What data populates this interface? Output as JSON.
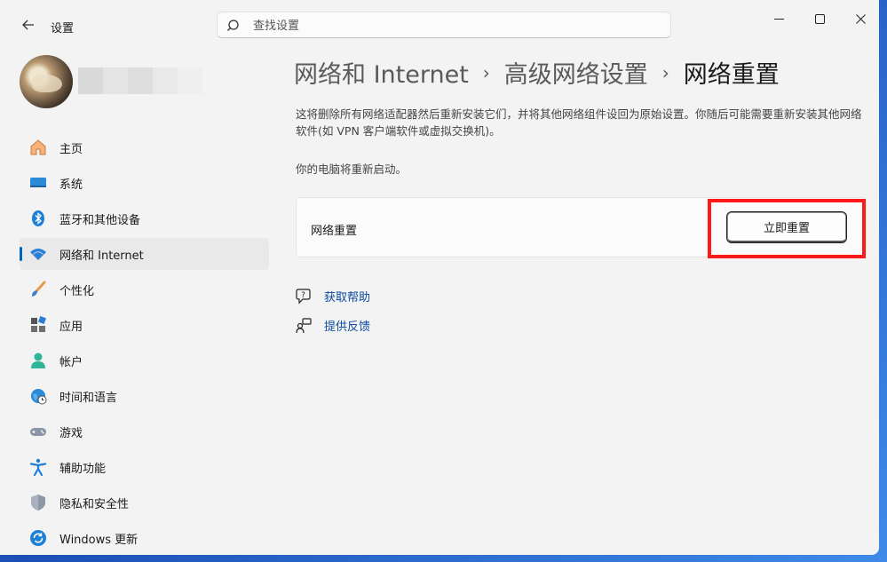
{
  "app": {
    "title": "设置",
    "back_label": "←"
  },
  "search": {
    "placeholder": "查找设置",
    "value": ""
  },
  "window_controls": {
    "minimize": "—",
    "maximize": "☐",
    "close": "✕"
  },
  "sidebar": {
    "items": [
      {
        "label": "主页",
        "icon": "home-icon"
      },
      {
        "label": "系统",
        "icon": "system-icon"
      },
      {
        "label": "蓝牙和其他设备",
        "icon": "bluetooth-icon"
      },
      {
        "label": "网络和 Internet",
        "icon": "wifi-icon",
        "active": true
      },
      {
        "label": "个性化",
        "icon": "brush-icon"
      },
      {
        "label": "应用",
        "icon": "apps-icon"
      },
      {
        "label": "帐户",
        "icon": "account-icon"
      },
      {
        "label": "时间和语言",
        "icon": "globe-clock-icon"
      },
      {
        "label": "游戏",
        "icon": "gamepad-icon"
      },
      {
        "label": "辅助功能",
        "icon": "accessibility-icon"
      },
      {
        "label": "隐私和安全性",
        "icon": "shield-icon"
      },
      {
        "label": "Windows 更新",
        "icon": "update-icon"
      }
    ]
  },
  "breadcrumb": {
    "level1": "网络和 Internet",
    "level2": "高级网络设置",
    "current": "网络重置",
    "sep": "›"
  },
  "main": {
    "description": "这将删除所有网络适配器然后重新安装它们，并将其他网络组件设回为原始设置。你随后可能需要重新安装其他网络软件(如 VPN 客户端软件或虚拟交换机)。",
    "restart_note": "你的电脑将重新启动。",
    "card": {
      "label": "网络重置",
      "button_label": "立即重置"
    },
    "links": {
      "help": "获取帮助",
      "feedback": "提供反馈"
    }
  },
  "colors": {
    "accent": "#0067c0",
    "highlight": "#ff1a1a",
    "link": "#0a4a9e"
  }
}
